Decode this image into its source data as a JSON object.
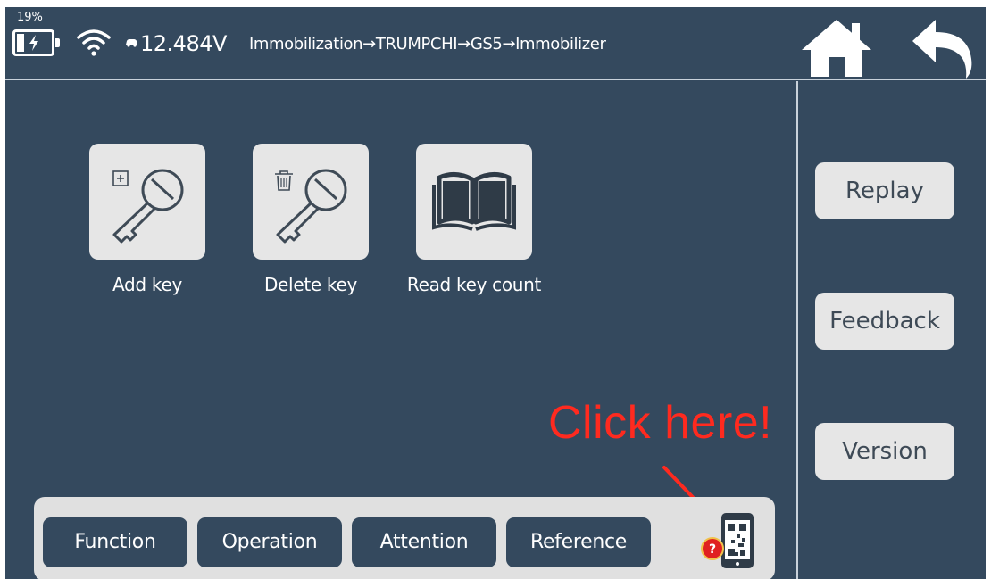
{
  "status": {
    "battery_percent": "19%",
    "battery_level": 0.19,
    "voltage": "12.484V",
    "breadcrumb": "Immobilization→TRUMPCHI→GS5→Immobilizer"
  },
  "tiles": [
    {
      "label": "Add key",
      "icon": "add-key-icon"
    },
    {
      "label": "Delete key",
      "icon": "delete-key-icon"
    },
    {
      "label": "Read key count",
      "icon": "book-icon"
    }
  ],
  "side_buttons": {
    "replay": "Replay",
    "feedback": "Feedback",
    "version": "Version"
  },
  "bottom_tabs": {
    "function": "Function",
    "operation": "Operation",
    "attention": "Attention",
    "reference": "Reference"
  },
  "annotation": {
    "text": "Click here!",
    "color": "#ff2a1f"
  },
  "colors": {
    "background": "#34495e",
    "button_light": "#e6e6e6",
    "annotation": "#ff2a1f"
  }
}
